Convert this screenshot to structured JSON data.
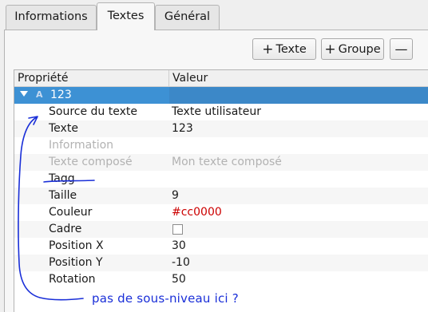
{
  "tabs": [
    {
      "label": "Informations"
    },
    {
      "label": "Textes"
    },
    {
      "label": "Général"
    }
  ],
  "toolbar": {
    "add_text_label": "Texte",
    "add_group_label": "Groupe",
    "plus_symbol": "+",
    "remove_symbol": "—"
  },
  "tree": {
    "header": {
      "property": "Propriété",
      "value": "Valeur"
    },
    "parent": {
      "icon_letter": "A",
      "name": "123"
    },
    "rows": [
      {
        "key": "Source du texte",
        "value": "Texte utilisateur"
      },
      {
        "key": "Texte",
        "value": "123"
      },
      {
        "key": "Information",
        "value": ""
      },
      {
        "key": "Texte composé",
        "value": "Mon texte composé"
      },
      {
        "key": "Tagg",
        "value": ""
      },
      {
        "key": "Taille",
        "value": "9"
      },
      {
        "key": "Couleur",
        "value": "#cc0000"
      },
      {
        "key": "Cadre",
        "value": ""
      },
      {
        "key": "Position X",
        "value": "30"
      },
      {
        "key": "Position Y",
        "value": "-10"
      },
      {
        "key": "Rotation",
        "value": "50"
      }
    ]
  },
  "annotation": {
    "text": "pas de sous-niveau ici ?",
    "color": "#1a2fd8"
  },
  "colors": {
    "selection": "#3d91d4",
    "color_value": "#cc0000"
  }
}
